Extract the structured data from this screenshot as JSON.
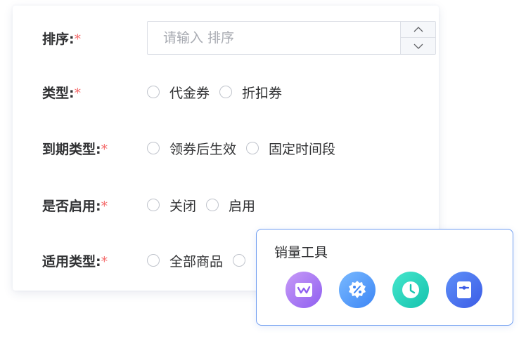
{
  "form": {
    "required_mark": "*",
    "sort": {
      "label": "排序:",
      "placeholder": "请输入 排序"
    },
    "type": {
      "label": "类型:",
      "options": [
        "代金券",
        "折扣券"
      ]
    },
    "expiry_type": {
      "label": "到期类型:",
      "options": [
        "领券后生效",
        "固定时间段"
      ]
    },
    "enabled": {
      "label": "是否启用:",
      "options": [
        "关闭",
        "启用"
      ]
    },
    "applicable_type": {
      "label": "适用类型:",
      "options": [
        "全部商品"
      ]
    }
  },
  "popup": {
    "title": "销量工具",
    "tools": [
      {
        "icon": "wave-chart-icon",
        "color_from": "#c08cf5",
        "color_to": "#8a5cf0"
      },
      {
        "icon": "percent-badge-icon",
        "color_from": "#6fb2ff",
        "color_to": "#3d86f5"
      },
      {
        "icon": "clock-icon",
        "color_from": "#3ee3c8",
        "color_to": "#15c6b2"
      },
      {
        "icon": "ticket-icon",
        "color_from": "#5b8cf7",
        "color_to": "#3f5fe8"
      }
    ]
  }
}
